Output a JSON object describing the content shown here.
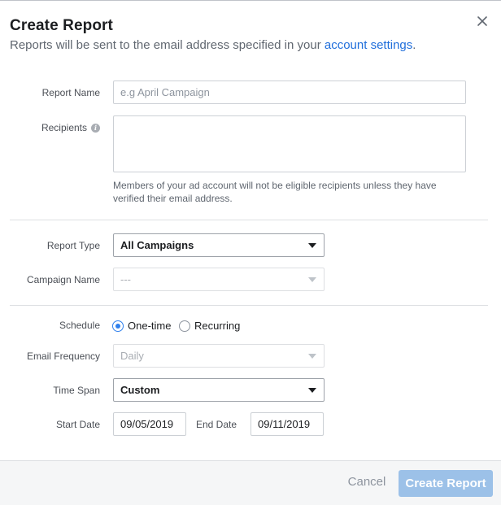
{
  "dialog": {
    "title": "Create Report",
    "subtitle_prefix": "Reports will be sent to the email address specified in your ",
    "subtitle_link": "account settings",
    "subtitle_suffix": ".",
    "close_icon": "close-icon"
  },
  "form": {
    "report_name": {
      "label": "Report Name",
      "placeholder": "e.g April Campaign",
      "value": ""
    },
    "recipients": {
      "label": "Recipients",
      "info_icon": "info-icon",
      "value": "",
      "hint": "Members of your ad account will not be eligible recipients unless they have verified their email address."
    },
    "report_type": {
      "label": "Report Type",
      "value": "All Campaigns"
    },
    "campaign_name": {
      "label": "Campaign Name",
      "value": "---"
    },
    "schedule": {
      "label": "Schedule",
      "options": [
        {
          "label": "One-time",
          "selected": true
        },
        {
          "label": "Recurring",
          "selected": false
        }
      ]
    },
    "email_frequency": {
      "label": "Email Frequency",
      "value": "Daily"
    },
    "time_span": {
      "label": "Time Span",
      "value": "Custom"
    },
    "start_date": {
      "label": "Start Date",
      "value": "09/05/2019"
    },
    "end_date": {
      "label": "End Date",
      "value": "09/11/2019"
    }
  },
  "footer": {
    "cancel_label": "Cancel",
    "submit_label": "Create Report"
  },
  "colors": {
    "link": "#216fdb",
    "radio_selected": "#2f80ed",
    "primary_button": "#9cc1e8",
    "footer_bg": "#f5f6f7"
  }
}
